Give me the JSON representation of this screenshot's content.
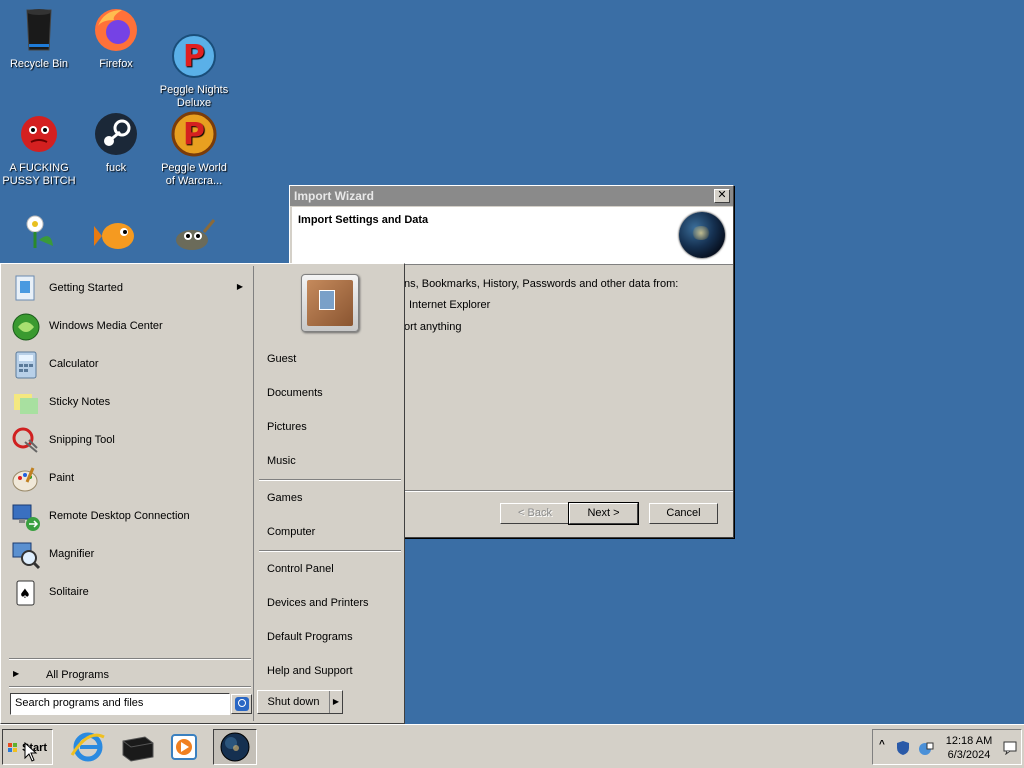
{
  "desktop": {
    "icons": [
      {
        "label": "Recycle Bin",
        "icon": "recycle-bin-icon"
      },
      {
        "label": "Firefox",
        "icon": "firefox-icon"
      },
      {
        "label": "Peggle Nights\nDeluxe",
        "icon": "peggle-nights-icon"
      },
      {
        "label": "A FUCKING\nPUSSY BITCH",
        "icon": "red-creature-icon"
      },
      {
        "label": "fuck",
        "icon": "steam-icon"
      },
      {
        "label": "Peggle World\nof Warcra...",
        "icon": "peggle-wow-icon"
      },
      {
        "label": "",
        "icon": "flower-pot-icon"
      },
      {
        "label": "",
        "icon": "goldfish-icon"
      },
      {
        "label": "",
        "icon": "gimp-icon"
      }
    ]
  },
  "wizard": {
    "title": "Import Wizard",
    "header_title": "Import Settings and Data",
    "description": "ns, Bookmarks, History, Passwords and other data from:",
    "option1": "Internet Explorer",
    "option2": "ort anything",
    "back_label": "< Back",
    "next_label": "Next >",
    "cancel_label": "Cancel"
  },
  "start_menu": {
    "programs": [
      {
        "label": "Getting Started",
        "icon": "getting-started-icon",
        "submenu": true
      },
      {
        "label": "Windows Media Center",
        "icon": "media-center-icon"
      },
      {
        "label": "Calculator",
        "icon": "calculator-icon"
      },
      {
        "label": "Sticky Notes",
        "icon": "sticky-notes-icon"
      },
      {
        "label": "Snipping Tool",
        "icon": "snipping-tool-icon"
      },
      {
        "label": "Paint",
        "icon": "paint-icon"
      },
      {
        "label": "Remote Desktop Connection",
        "icon": "remote-desktop-icon"
      },
      {
        "label": "Magnifier",
        "icon": "magnifier-icon"
      },
      {
        "label": "Solitaire",
        "icon": "solitaire-icon"
      }
    ],
    "all_programs": "All Programs",
    "search_placeholder": "Search programs and files",
    "right_links": [
      "Guest",
      "Documents",
      "Pictures",
      "Music",
      "Games",
      "Computer",
      "Control Panel",
      "Devices and Printers",
      "Default Programs",
      "Help and Support"
    ],
    "shutdown_label": "Shut down"
  },
  "taskbar": {
    "start_label": "Start",
    "apps": [
      "internet-explorer-icon",
      "black-box-icon",
      "media-player-icon",
      "import-wizard-globe-icon"
    ],
    "tray_expand": "^",
    "clock_time": "12:18 AM",
    "clock_date": "6/3/2024"
  },
  "colors": {
    "desktop": "#3a6ea5",
    "window": "#d4d0c8",
    "titlebar_inactive": "#8a8a8a"
  }
}
